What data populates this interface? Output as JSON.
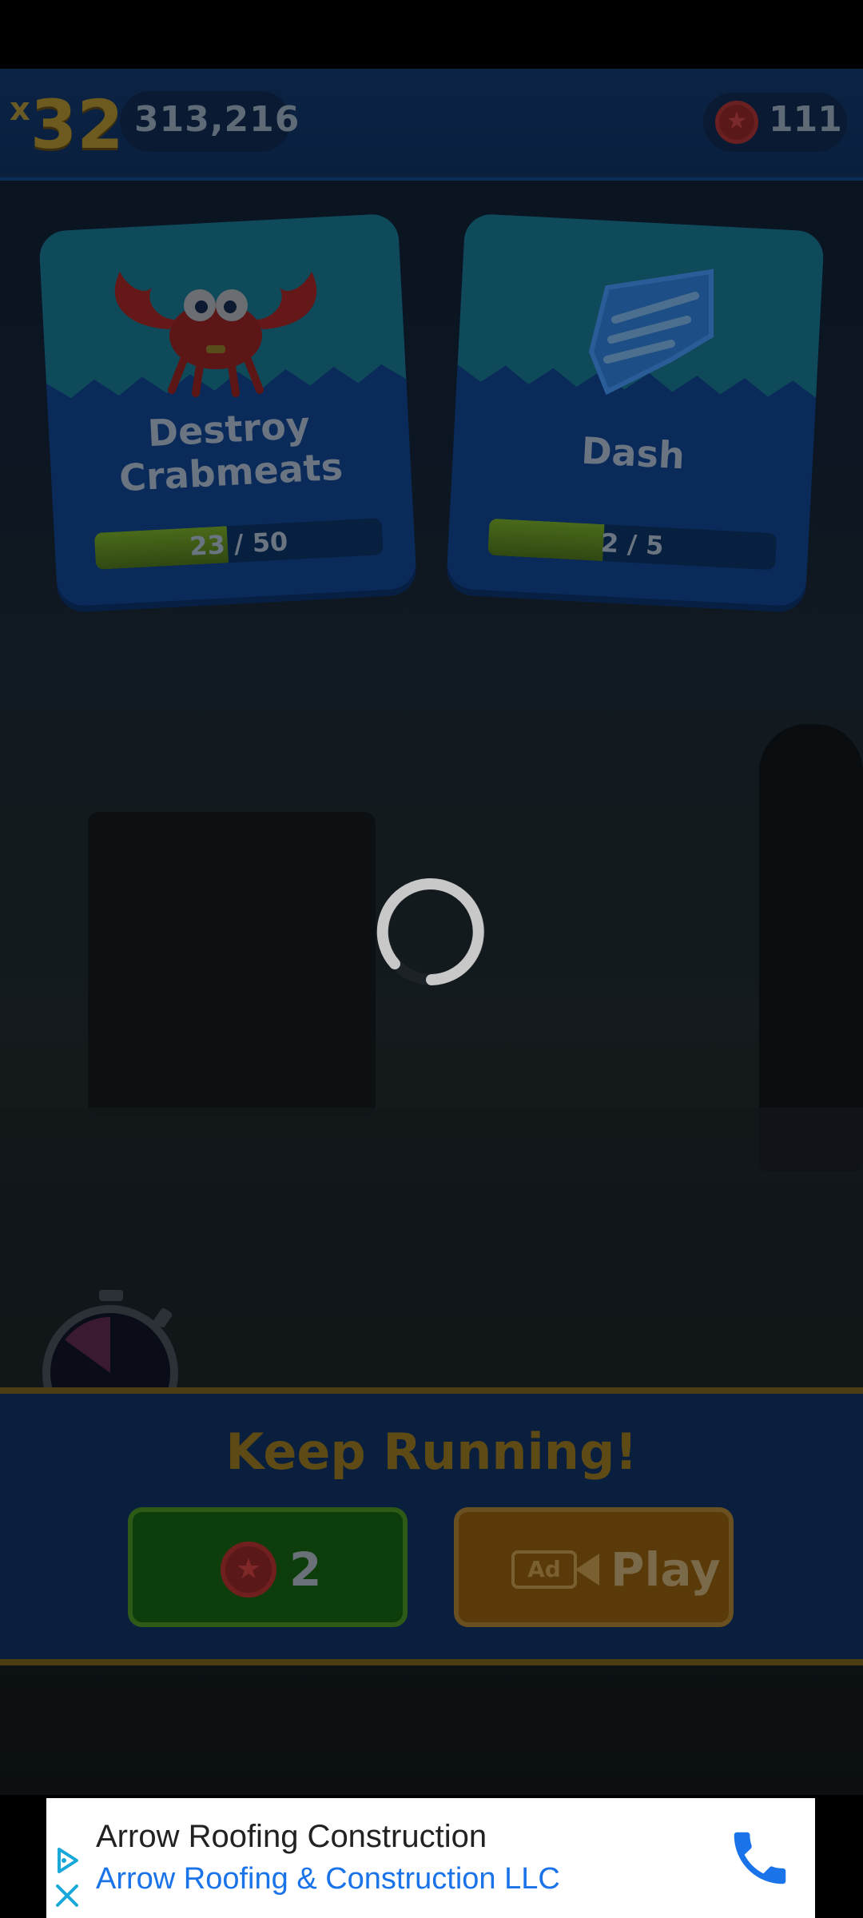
{
  "hud": {
    "multiplier_x": "x",
    "multiplier": "32",
    "score": "313,216",
    "rings": "111"
  },
  "missions": [
    {
      "title_line1": "Destroy",
      "title_line2": "Crabmeats",
      "progress_current": "23",
      "progress_total": "50",
      "progress_text": "23 / 50",
      "progress": 0.46,
      "icon": "crabmeat-icon"
    },
    {
      "title_line1": "Dash",
      "title_line2": "",
      "progress_current": "2",
      "progress_total": "5",
      "progress_text": "2 / 5",
      "progress": 0.4,
      "icon": "dash-shoe-icon"
    }
  ],
  "continue_panel": {
    "heading": "Keep Running!",
    "ring_cost": "2",
    "ad_label": "Ad",
    "play_label": "Play",
    "timer_progress": 0.15
  },
  "ad_banner": {
    "title": "Arrow Roofing Construction",
    "subtitle": "Arrow Roofing & Construction LLC"
  },
  "colors": {
    "accent_gold": "#f5b800",
    "ring_red": "#d61f1f",
    "ad_link_blue": "#1a73e8",
    "button_green": "#1e9e12",
    "button_orange": "#f39a1a"
  }
}
